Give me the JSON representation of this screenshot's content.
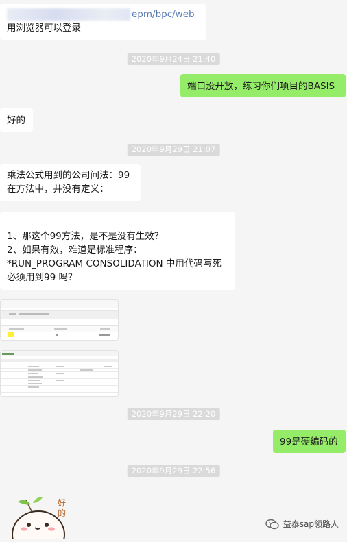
{
  "messages": {
    "m1_url": "epm/bpc/web",
    "m1_text": "用浏览器可以登录",
    "t1": "2020年9月24日 21:40",
    "m2": "端口没开放，练习你们项目的BASIS",
    "m3": "好的",
    "t2": "2020年9月29日 21:07",
    "m4_l1": "乘法公式用到的公司间法：99",
    "m4_l2": "在方法中，并没有定义：",
    "m5_l1": "1、那这个99方法，是不是没有生效？",
    "m5_l2": "2、如果有效，难道是标准程序：",
    "m5_l3": "*RUN_PROGRAM CONSOLIDATION 中用代码写死",
    "m5_l4": "必须用到99 吗？",
    "t3": "2020年9月29日 22:20",
    "m6": "99是硬编码的",
    "t4": "2020年9月29日 22:56"
  },
  "sticker": {
    "text1": "好",
    "text2": "的"
  },
  "watermark": {
    "text": "益泰sap领路人",
    "icon": "wechat-icon"
  },
  "colors": {
    "bg": "#f5f5f5",
    "green_bubble": "#95ec69",
    "white_bubble": "#ffffff",
    "time_bg": "#dadada"
  }
}
